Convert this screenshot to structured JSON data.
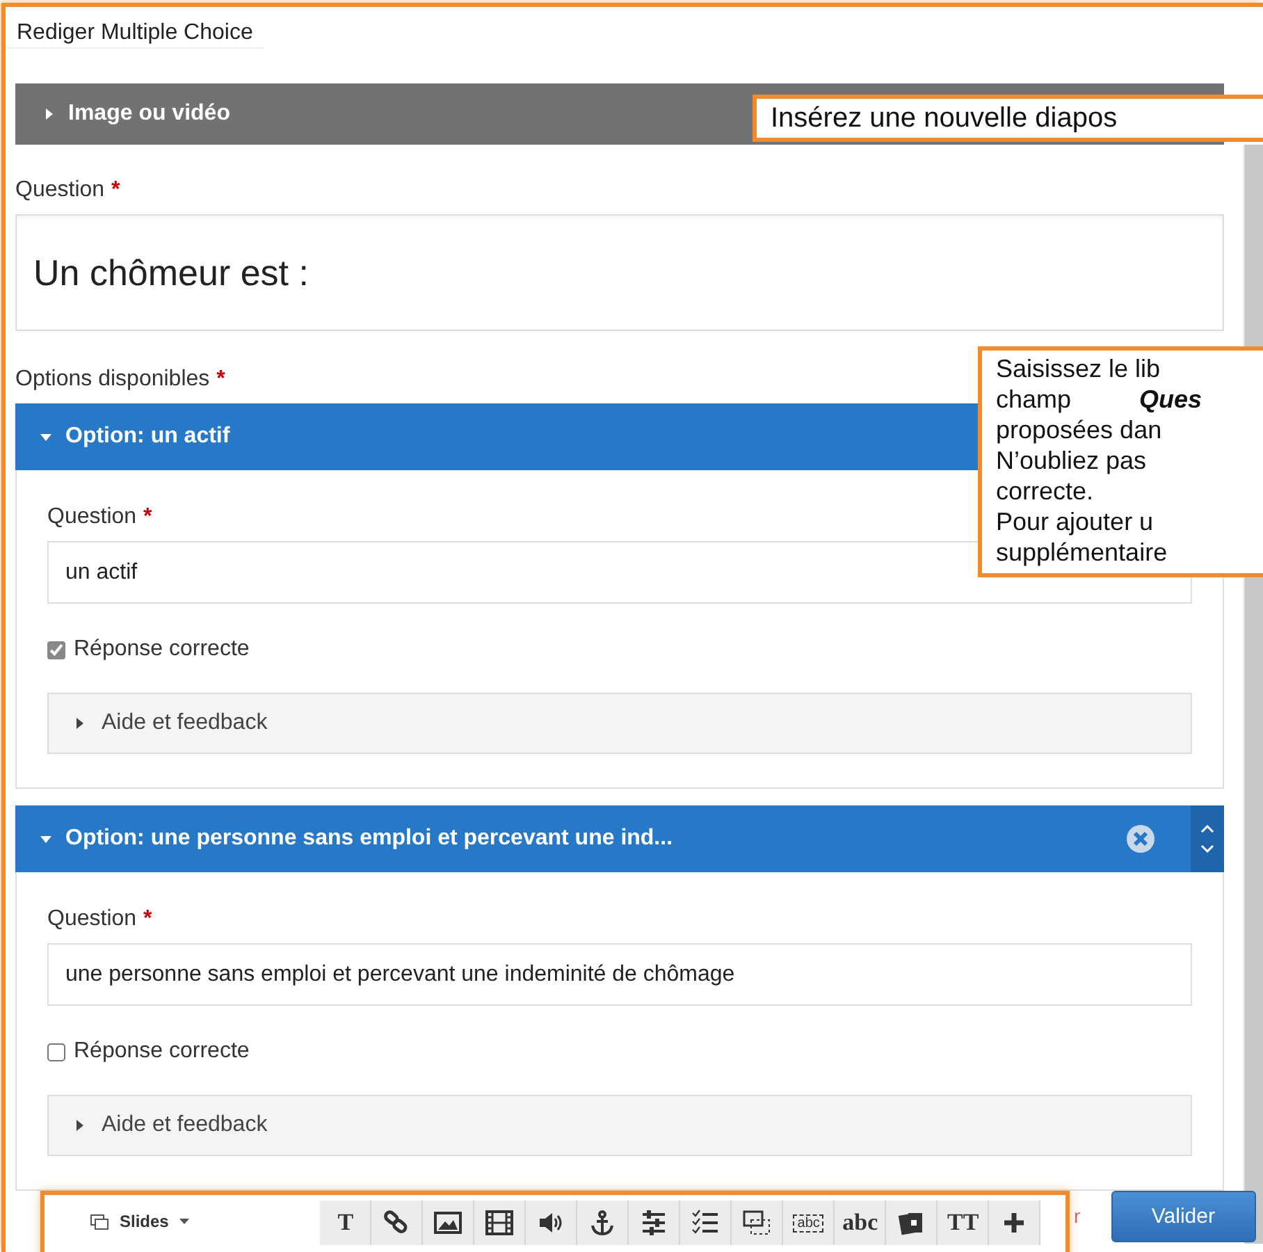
{
  "dialog": {
    "title": "Rediger Multiple Choice"
  },
  "media_section": {
    "label": "Image ou vidéo",
    "expanded": false
  },
  "question": {
    "label": "Question",
    "required_mark": "*",
    "value": "Un chômeur est :"
  },
  "options_heading": {
    "label": "Options disponibles",
    "required_mark": "*"
  },
  "options": [
    {
      "header": "Option: un actif",
      "expanded": true,
      "controls": false,
      "question_label": "Question",
      "required_mark": "*",
      "value": "un actif",
      "correct_label": "Réponse correcte",
      "checked": true,
      "feedback_label": "Aide et feedback"
    },
    {
      "header": "Option: une personne sans emploi et percevant une ind...",
      "expanded": true,
      "controls": true,
      "question_label": "Question",
      "required_mark": "*",
      "value": "une personne sans emploi et percevant une indeminité de chômage",
      "correct_label": "Réponse correcte",
      "checked": false,
      "feedback_label": "Aide et feedback"
    }
  ],
  "toolbar": {
    "slides_label": "Slides",
    "tools": [
      {
        "kind": "glyph",
        "glyph": "T"
      },
      {
        "kind": "link"
      },
      {
        "kind": "image"
      },
      {
        "kind": "film"
      },
      {
        "kind": "sound"
      },
      {
        "kind": "anchor"
      },
      {
        "kind": "sliders"
      },
      {
        "kind": "checklist"
      },
      {
        "kind": "dropdown"
      },
      {
        "kind": "glyph",
        "glyph": "abc",
        "boxed": true
      },
      {
        "kind": "glyph",
        "glyph": "abc",
        "boxed": false
      },
      {
        "kind": "cards"
      },
      {
        "kind": "glyph",
        "glyph": "TT"
      },
      {
        "kind": "plus"
      }
    ]
  },
  "partial_link": "r",
  "submit_button": "Valider",
  "callouts": [
    {
      "lines": [
        "Insérez une nouvelle diapos"
      ]
    },
    {
      "lines": [
        "Saisissez le lib",
        "champ **Ques**",
        "proposées dan",
        "N’oubliez pas",
        "correcte.",
        "Pour ajouter u",
        "supplémentaire"
      ]
    }
  ]
}
